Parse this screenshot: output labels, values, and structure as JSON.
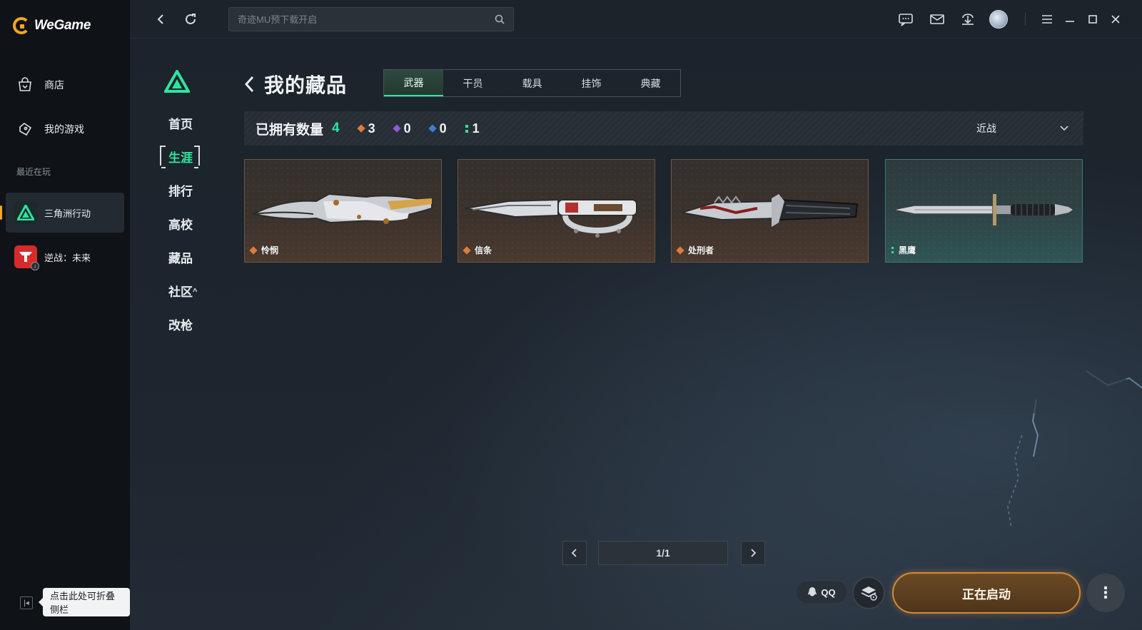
{
  "app": {
    "name": "WeGame"
  },
  "sidebar": {
    "items": [
      {
        "label": "商店",
        "icon": "shop-bag-icon"
      },
      {
        "label": "我的游戏",
        "icon": "gamepad-icon"
      }
    ],
    "recent_title": "最近在玩",
    "recent": [
      {
        "label": "三角洲行动",
        "active": true
      },
      {
        "label": "逆战：未来",
        "active": false
      }
    ],
    "collapse_tooltip": "点击此处可折叠侧栏"
  },
  "topbar": {
    "search_placeholder": "奇迹MU预下载开启"
  },
  "game_nav": {
    "items": [
      {
        "label": "首页"
      },
      {
        "label": "生涯",
        "active": true
      },
      {
        "label": "排行"
      },
      {
        "label": "高校"
      },
      {
        "label": "藏品"
      },
      {
        "label": "社区",
        "suffix": "^"
      },
      {
        "label": "改枪"
      }
    ]
  },
  "collection": {
    "title": "我的藏品",
    "tabs": [
      {
        "label": "武器",
        "active": true
      },
      {
        "label": "干员"
      },
      {
        "label": "载具"
      },
      {
        "label": "挂饰"
      },
      {
        "label": "典藏"
      }
    ],
    "owned_label": "已拥有数量",
    "owned_total": "4",
    "rarity_counts": [
      {
        "value": "3",
        "color": "#e07b3c"
      },
      {
        "value": "0",
        "color": "#8a5cd6"
      },
      {
        "value": "0",
        "color": "#3a7fd6"
      },
      {
        "value": "1",
        "color": "#2ee59d"
      }
    ],
    "filter": "近战",
    "items": [
      {
        "name": "怜悯",
        "rarity_color": "#e07b3c",
        "style": "gold"
      },
      {
        "name": "信条",
        "rarity_color": "#e07b3c",
        "style": "gold"
      },
      {
        "name": "处刑者",
        "rarity_color": "#e07b3c",
        "style": "gold"
      },
      {
        "name": "黑鹰",
        "rarity_color": "#2ee59d",
        "style": "teal"
      }
    ]
  },
  "pagination": {
    "current": "1/1"
  },
  "launcher": {
    "qq_label": "QQ",
    "launch_label": "正在启动",
    "more_label": "⋮"
  },
  "colors": {
    "accent_green": "#2ee59d",
    "accent_orange": "#d38a3b"
  }
}
